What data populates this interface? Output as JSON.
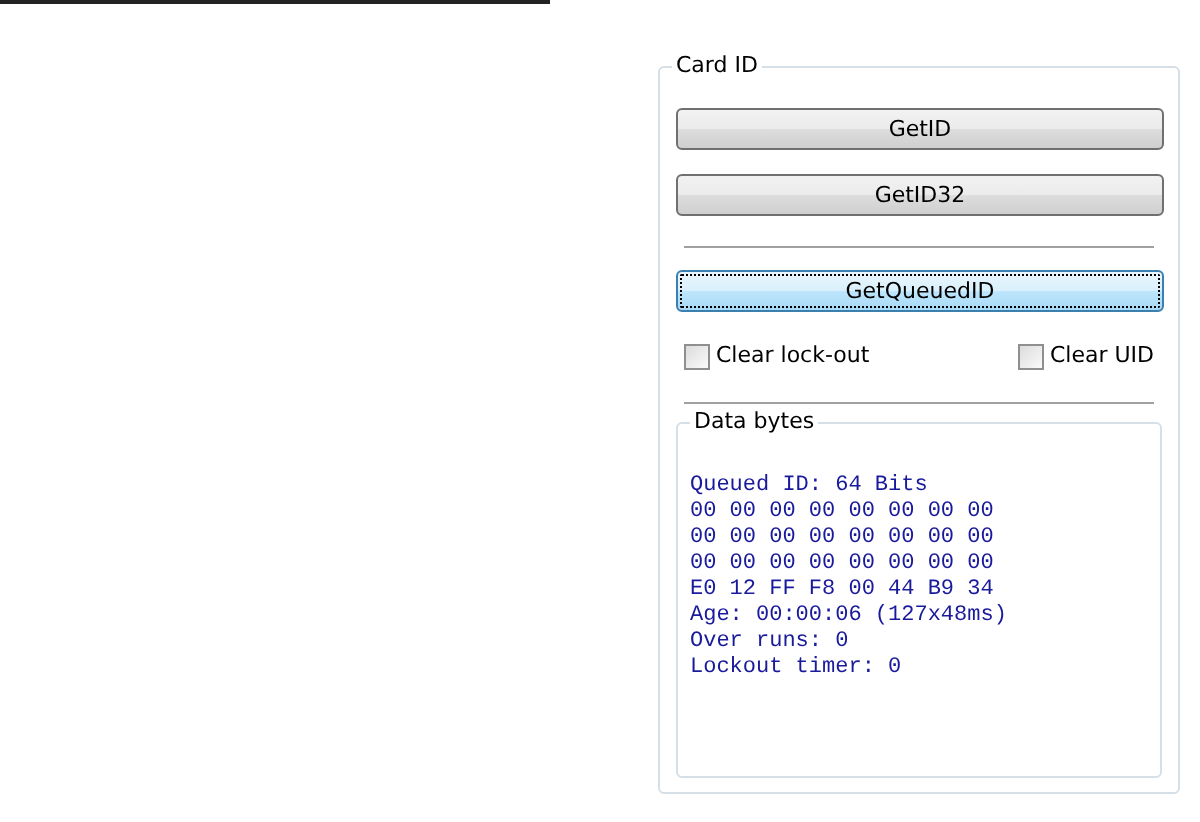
{
  "group": {
    "title": "Card ID",
    "buttons": [
      {
        "label": "GetID",
        "focused": false
      },
      {
        "label": "GetID32",
        "focused": false
      }
    ],
    "queued_button": {
      "label": "GetQueuedID",
      "focused": true
    },
    "checkboxes": [
      {
        "label": "Clear lock-out",
        "checked": false
      },
      {
        "label": "Clear UID",
        "checked": false
      }
    ],
    "data_bytes": {
      "title": "Data bytes",
      "lines": [
        "Queued ID: 64 Bits",
        "00 00 00 00 00 00 00 00",
        "00 00 00 00 00 00 00 00",
        "00 00 00 00 00 00 00 00",
        "E0 12 FF F8 00 44 B9 34",
        "Age: 00:00:06 (127x48ms)",
        "Over runs: 0",
        "Lockout timer: 0"
      ]
    }
  }
}
